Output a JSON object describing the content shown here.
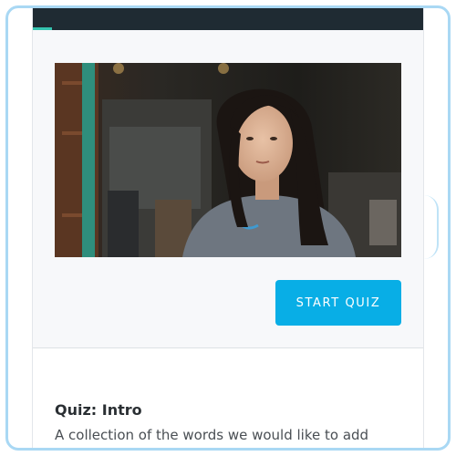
{
  "header": {
    "progress": 0.05
  },
  "video": {
    "description_icon": "video-frame"
  },
  "quiz": {
    "start_label": "START QUIZ",
    "title": "Quiz: Intro",
    "description": "A collection of the words we would like to add"
  },
  "colors": {
    "topbar": "#1f2b33",
    "progress": "#35c4b0",
    "accent_button": "#08aee6",
    "frame_border": "#a9d8f4"
  }
}
